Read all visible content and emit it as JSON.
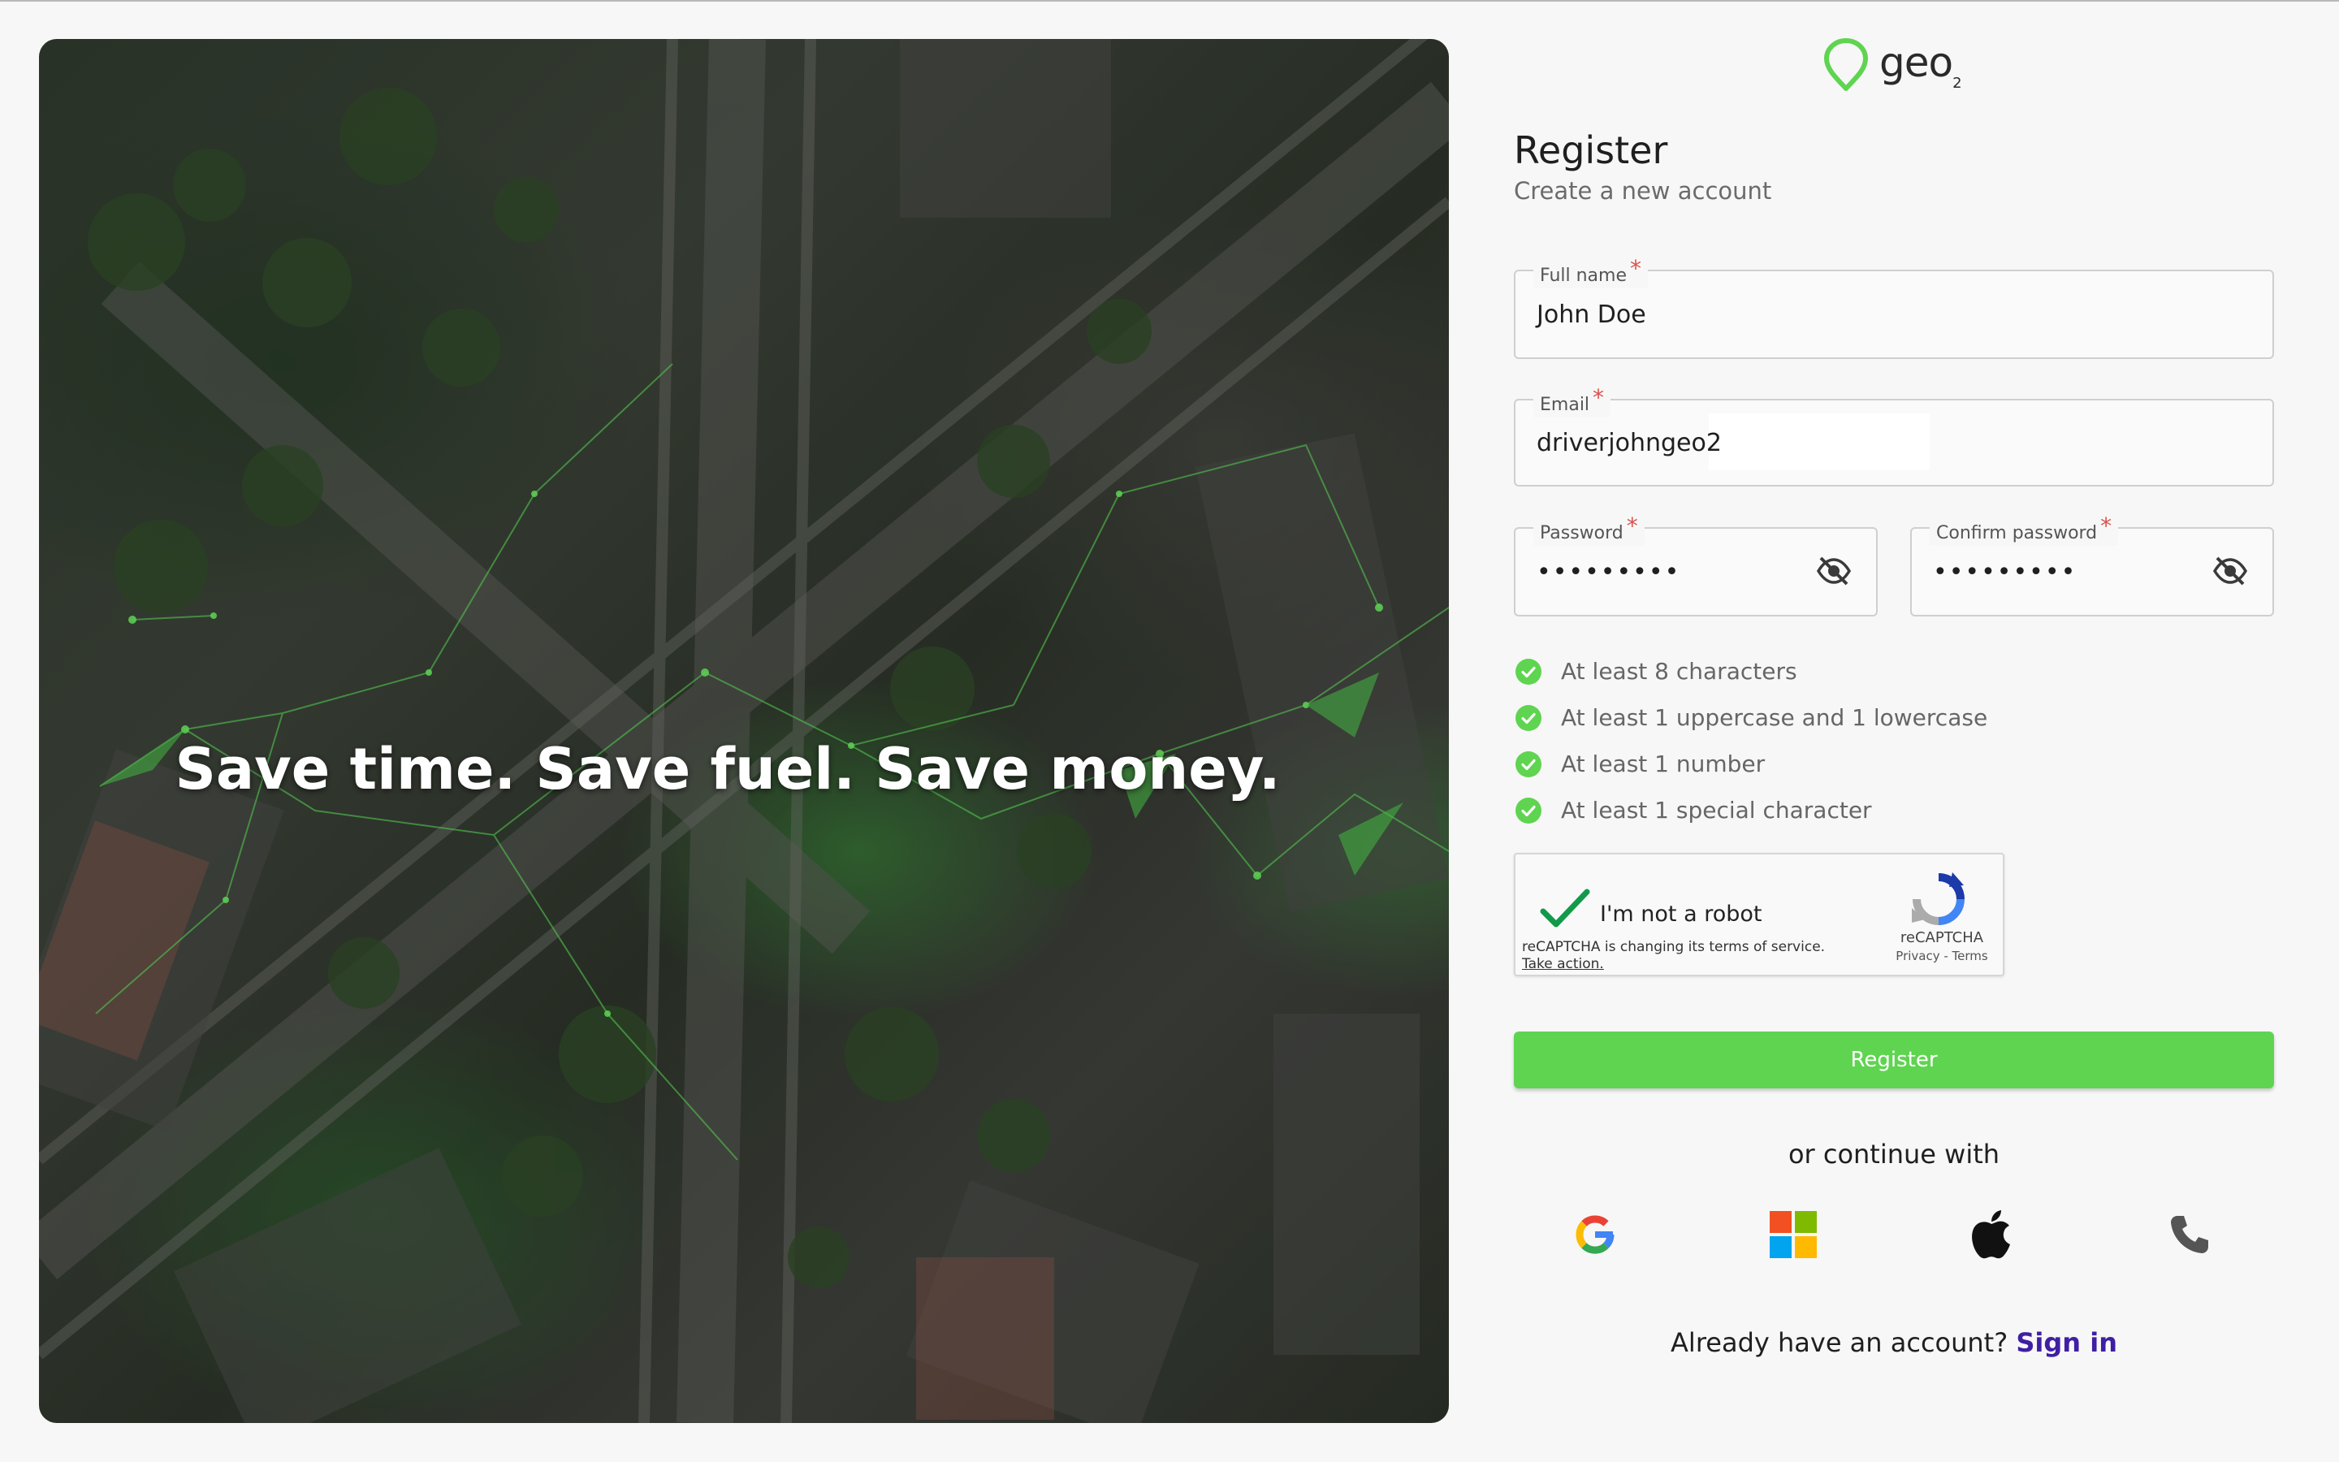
{
  "hero": {
    "headline": "Save time. Save fuel. Save money."
  },
  "brand": {
    "logo_text": "geo",
    "logo_sub": "2",
    "accent_color": "#5fd450",
    "link_color": "#3f1fa3"
  },
  "header": {
    "title": "Register",
    "subtitle": "Create a new account"
  },
  "form": {
    "full_name": {
      "label": "Full name",
      "required_mark": "*",
      "value": "John Doe"
    },
    "email": {
      "label": "Email",
      "required_mark": "*",
      "value": "driverjohngeo2"
    },
    "password": {
      "label": "Password",
      "required_mark": "*",
      "value": "•••••••••",
      "toggle_icon": "eye-off-icon"
    },
    "confirm_password": {
      "label": "Confirm password",
      "required_mark": "*",
      "value": "•••••••••",
      "toggle_icon": "eye-off-icon"
    }
  },
  "password_rules": [
    {
      "text": "At least 8 characters",
      "met": true
    },
    {
      "text": "At least 1 uppercase and 1 lowercase",
      "met": true
    },
    {
      "text": "At least 1 number",
      "met": true
    },
    {
      "text": "At least 1 special character",
      "met": true
    }
  ],
  "captcha": {
    "label": "I'm not a robot",
    "checked": true,
    "notice": "reCAPTCHA is changing its terms of service.",
    "notice_link": "Take action.",
    "brand": "reCAPTCHA",
    "terms": "Privacy - Terms"
  },
  "actions": {
    "register_label": "Register",
    "continue_with": "or continue with",
    "providers": [
      "google-icon",
      "microsoft-icon",
      "apple-icon",
      "phone-icon"
    ],
    "signin_prompt": "Already have an account?",
    "signin_label": "Sign in"
  }
}
